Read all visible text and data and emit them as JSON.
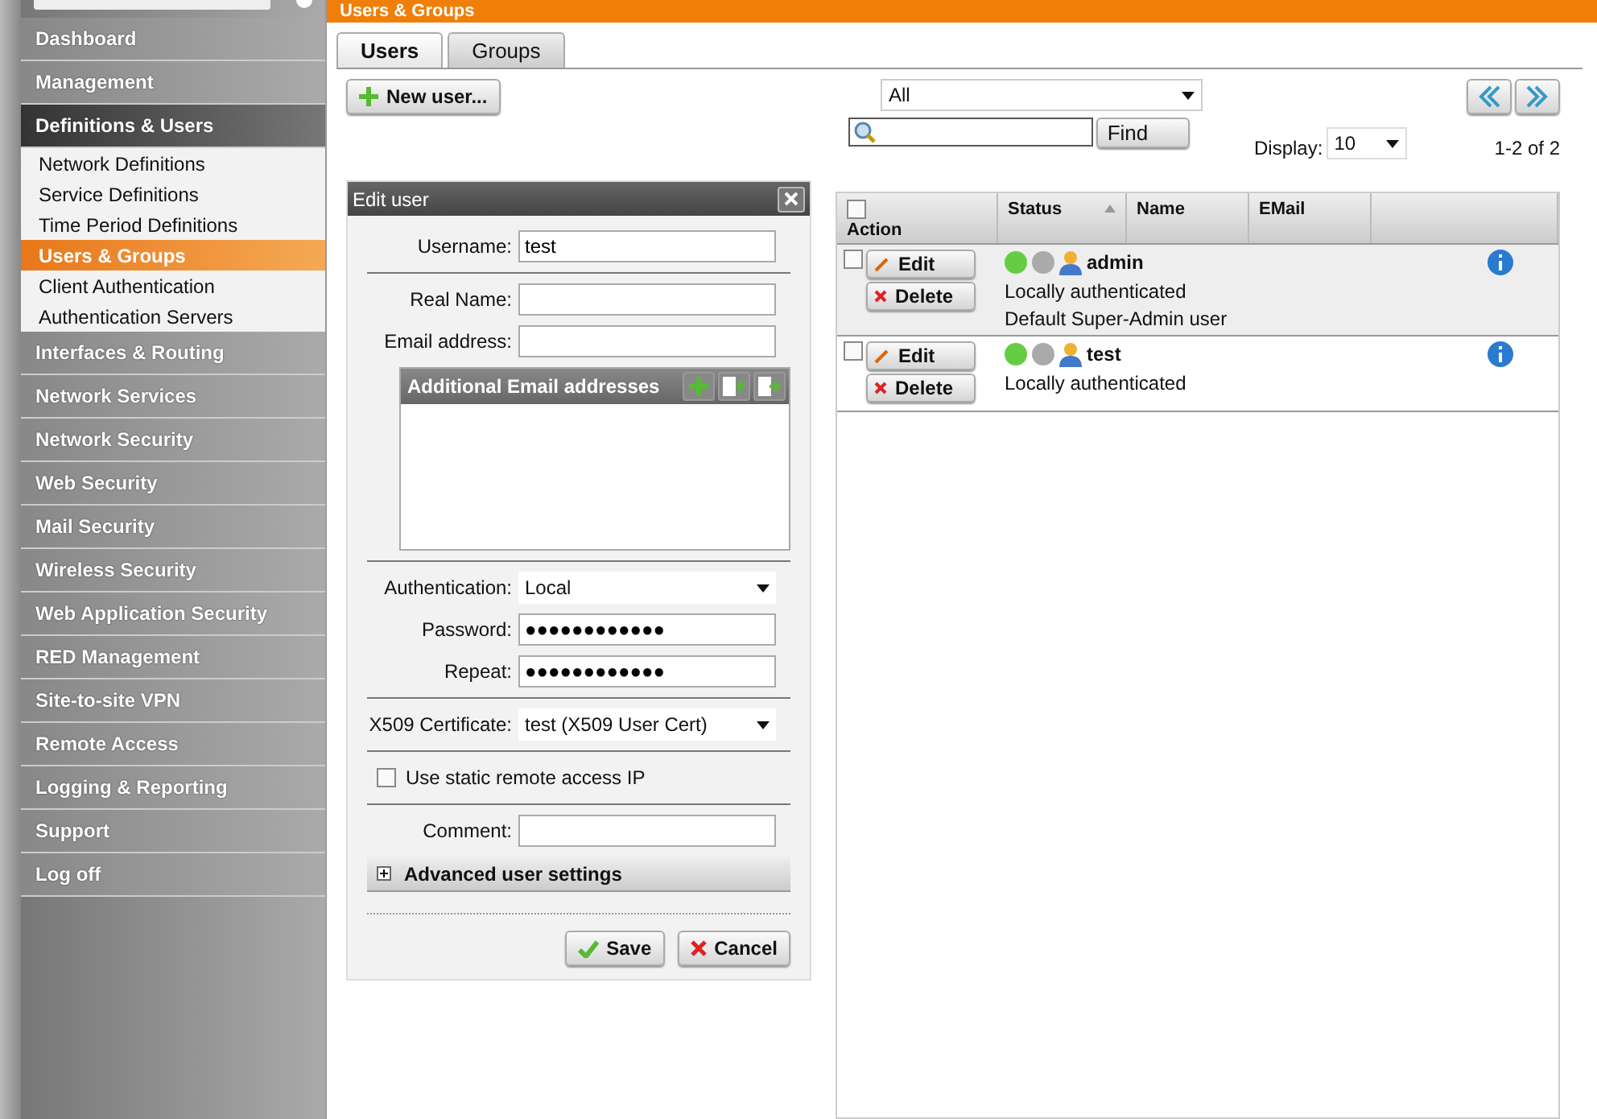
{
  "header": {
    "title": "Users & Groups"
  },
  "sidebar": {
    "items": [
      {
        "label": "Dashboard",
        "selected": false
      },
      {
        "label": "Management",
        "selected": false
      },
      {
        "label": "Definitions & Users",
        "selected": true,
        "expanded": true,
        "children": [
          {
            "label": "Network Definitions",
            "selected": false
          },
          {
            "label": "Service Definitions",
            "selected": false
          },
          {
            "label": "Time Period Definitions",
            "selected": false
          },
          {
            "label": "Users & Groups",
            "selected": true
          },
          {
            "label": "Client Authentication",
            "selected": false
          },
          {
            "label": "Authentication Servers",
            "selected": false
          }
        ]
      },
      {
        "label": "Interfaces & Routing",
        "selected": false
      },
      {
        "label": "Network Services",
        "selected": false
      },
      {
        "label": "Network Security",
        "selected": false
      },
      {
        "label": "Web Security",
        "selected": false
      },
      {
        "label": "Mail Security",
        "selected": false
      },
      {
        "label": "Wireless Security",
        "selected": false
      },
      {
        "label": "Web Application Security",
        "selected": false
      },
      {
        "label": "RED Management",
        "selected": false
      },
      {
        "label": "Site-to-site VPN",
        "selected": false
      },
      {
        "label": "Remote Access",
        "selected": false
      },
      {
        "label": "Logging & Reporting",
        "selected": false
      },
      {
        "label": "Support",
        "selected": false
      },
      {
        "label": "Log off",
        "selected": false
      }
    ]
  },
  "tabs": [
    {
      "label": "Users",
      "selected": true
    },
    {
      "label": "Groups",
      "selected": false
    }
  ],
  "new_button": "New user...",
  "edit_user": {
    "title": "Edit user",
    "username": {
      "label": "Username:",
      "value": "test"
    },
    "real_name": {
      "label": "Real Name:"
    },
    "email": {
      "label": "Email address:"
    },
    "additional_emails": {
      "title": "Additional Email addresses"
    },
    "authentication": {
      "label": "Authentication:",
      "value": "Local"
    },
    "password": {
      "label": "Password:",
      "value": "●●●●●●●●●●●●"
    },
    "repeat": {
      "label": "Repeat:",
      "value": "●●●●●●●●●●●●"
    },
    "certificate": {
      "label": "X509 Certificate:",
      "value": "test (X509 User Cert)"
    },
    "static_ip": {
      "label": "Use static remote access IP",
      "checked": false
    },
    "comment": {
      "label": "Comment:"
    },
    "advanced": {
      "label": "Advanced user settings",
      "expanded": false
    },
    "save": "Save",
    "cancel": "Cancel"
  },
  "list": {
    "filter": "All",
    "find": "Find",
    "display_label": "Display:",
    "display_value": "10",
    "range": "1-2 of 2",
    "columns": [
      "Action",
      "Status",
      "Name",
      "EMail"
    ],
    "select_all_checked": false,
    "rows": [
      {
        "edit": "Edit",
        "delete": "Delete",
        "name": "admin",
        "enabled": true,
        "lines": [
          "Locally authenticated",
          "Default Super-Admin user"
        ],
        "checked": false
      },
      {
        "edit": "Edit",
        "delete": "Delete",
        "name": "test",
        "enabled": true,
        "lines": [
          "Locally authenticated"
        ],
        "checked": false
      }
    ]
  }
}
